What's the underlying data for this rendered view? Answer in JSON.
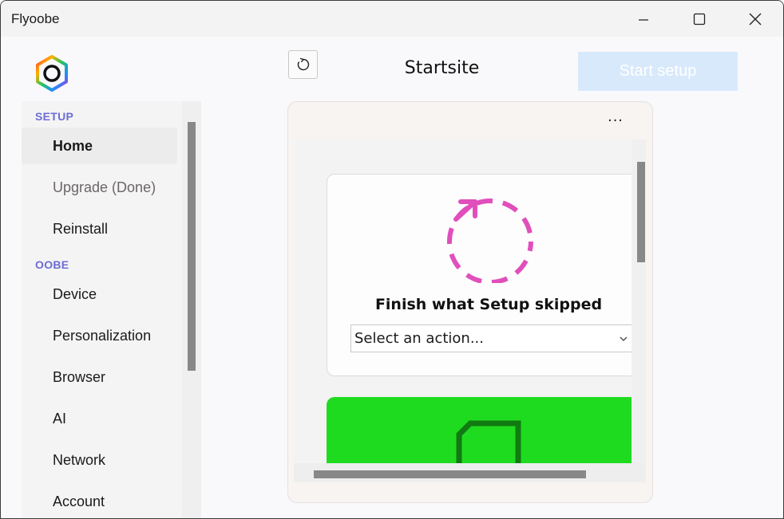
{
  "window": {
    "title": "Flyoobe"
  },
  "sidebar": {
    "sections": [
      {
        "header": "SETUP",
        "items": [
          {
            "label": "Home",
            "active": true
          },
          {
            "label": "Upgrade (Done)",
            "done": true
          },
          {
            "label": "Reinstall"
          }
        ]
      },
      {
        "header": "OOBE",
        "items": [
          {
            "label": "Device"
          },
          {
            "label": "Personalization"
          },
          {
            "label": "Browser"
          },
          {
            "label": "AI"
          },
          {
            "label": "Network"
          },
          {
            "label": "Account"
          }
        ]
      }
    ]
  },
  "header": {
    "refresh_icon": "refresh-icon",
    "title": "Startsite",
    "start_button": "Start setup"
  },
  "panel": {
    "more_label": "...",
    "card": {
      "icon": "dashed-circle-arrow-icon",
      "title": "Finish what Setup skipped",
      "select_value": "Select an action..."
    },
    "green_card": {
      "icon": "folder-outline-icon"
    }
  },
  "colors": {
    "accent": "#6d6dd4",
    "start_button_bg": "#d8e9fb",
    "card_icon": "#e04fbc",
    "green_card": "#1fdb1f",
    "green_icon": "#127a12"
  }
}
